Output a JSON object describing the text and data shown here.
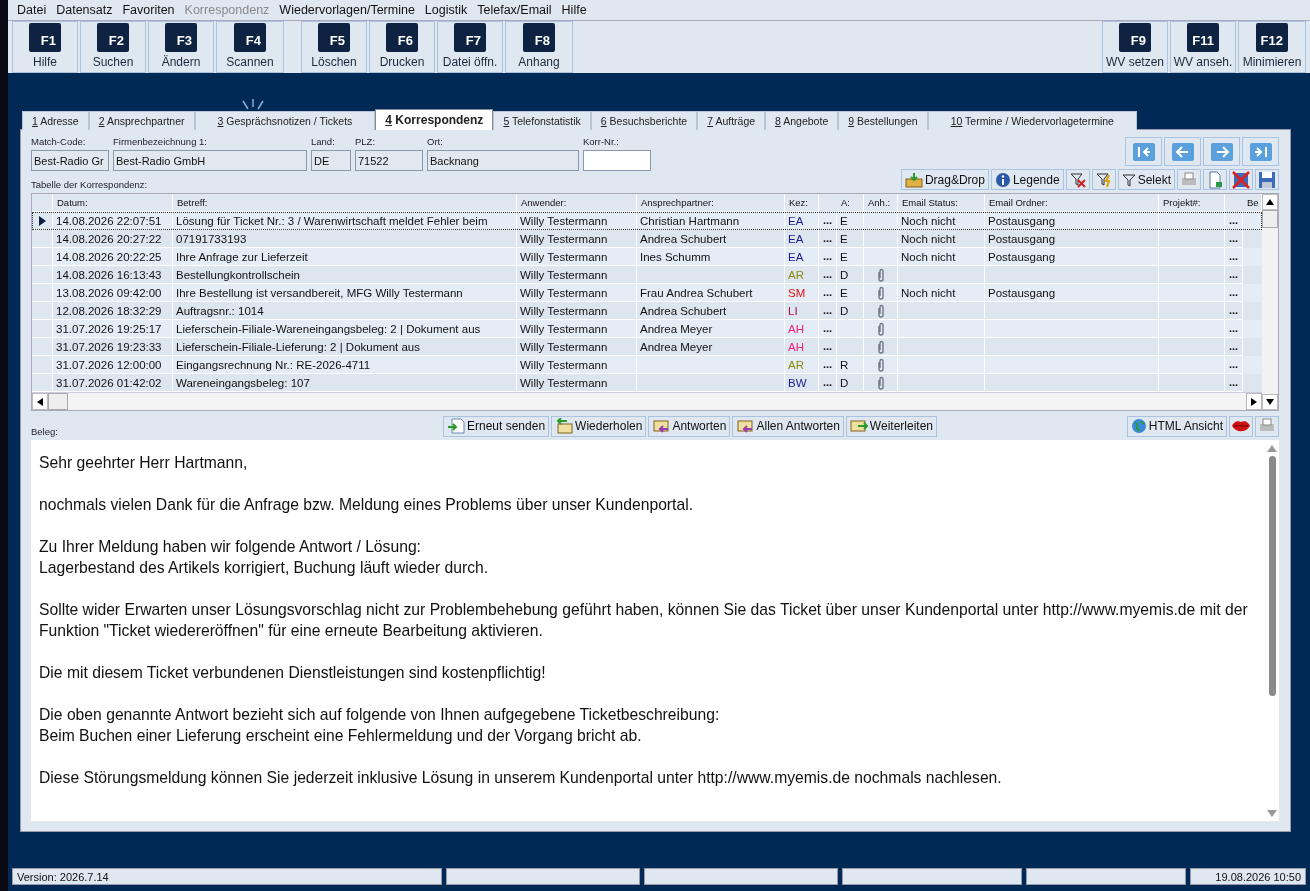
{
  "menu": [
    {
      "label": "Datei",
      "disabled": false
    },
    {
      "label": "Datensatz",
      "disabled": false
    },
    {
      "label": "Favoriten",
      "disabled": false
    },
    {
      "label": "Korrespondenz",
      "disabled": true
    },
    {
      "label": "Wiedervorlagen/Termine",
      "disabled": false
    },
    {
      "label": "Logistik",
      "disabled": false
    },
    {
      "label": "Telefax/Email",
      "disabled": false
    },
    {
      "label": "Hilfe",
      "disabled": false
    }
  ],
  "toolbar": {
    "groups": [
      [
        {
          "key": "F1",
          "label": "Hilfe"
        },
        {
          "key": "F2",
          "label": "Suchen"
        },
        {
          "key": "F3",
          "label": "Ändern"
        },
        {
          "key": "F4",
          "label": "Scannen"
        }
      ],
      [
        {
          "key": "F5",
          "label": "Löschen"
        },
        {
          "key": "F6",
          "label": "Drucken"
        },
        {
          "key": "F7",
          "label": "Datei öffn."
        },
        {
          "key": "F8",
          "label": "Anhang"
        }
      ]
    ],
    "right": [
      {
        "key": "F9",
        "label": "WV setzen"
      },
      {
        "key": "F11",
        "label": "WV anseh."
      },
      {
        "key": "F12",
        "label": "Minimieren"
      }
    ]
  },
  "tabs": [
    {
      "num": "1",
      "label": "Adresse",
      "selected": false
    },
    {
      "num": "2",
      "label": "Ansprechpartner",
      "selected": false
    },
    {
      "num": "3",
      "label": "Gesprächsnotizen / Tickets",
      "selected": false
    },
    {
      "num": "4",
      "label": "Korrespondenz",
      "selected": true
    },
    {
      "num": "5",
      "label": "Telefonstatistik",
      "selected": false
    },
    {
      "num": "6",
      "label": "Besuchsberichte",
      "selected": false
    },
    {
      "num": "7",
      "label": "Aufträge",
      "selected": false
    },
    {
      "num": "8",
      "label": "Angebote",
      "selected": false
    },
    {
      "num": "9",
      "label": "Bestellungen",
      "selected": false
    },
    {
      "num": "10",
      "label": "Termine / Wiedervorlagetermine",
      "selected": false
    }
  ],
  "fields": [
    {
      "label": "Match-Code:",
      "value": "Best-Radio Gr",
      "editable": false
    },
    {
      "label": "Firmenbezeichnung 1:",
      "value": "Best-Radio GmbH",
      "editable": false
    },
    {
      "label": "Land:",
      "value": "DE",
      "editable": false
    },
    {
      "label": "PLZ:",
      "value": "71522",
      "editable": false
    },
    {
      "label": "Ort:",
      "value": "Backnang",
      "editable": false
    },
    {
      "label": "Korr-Nr.:",
      "editable": true
    }
  ],
  "table_label": "Tabelle der Korrespondenz:",
  "table_tools": [
    {
      "kind": "dragdrop",
      "label": "Drag&Drop"
    },
    {
      "kind": "legend",
      "label": "Legende"
    },
    {
      "kind": "filter-off"
    },
    {
      "kind": "filter-flash"
    },
    {
      "kind": "filter",
      "label": "Selekt"
    },
    {
      "kind": "print"
    },
    {
      "kind": "export"
    },
    {
      "kind": "delete"
    },
    {
      "kind": "save"
    }
  ],
  "table": {
    "columns": [
      "Datum:",
      "Betreff:",
      "Anwender:",
      "Ansprechpartner:",
      "Kez:",
      "A:",
      "Anh.:",
      "Email Status:",
      "Email Ordner:",
      "Projekt#:",
      "Be"
    ],
    "rows": [
      {
        "selected": true,
        "date": "14.08.2026 22:07:51",
        "subject": "Lösung für Ticket Nr.: 3 / Warenwirtschaft meldet Fehler beim",
        "user": "Willy Testermann",
        "contact": "Christian Hartmann",
        "kez": "EA",
        "color": "#1c1c8c",
        "dots": "...",
        "a": "E",
        "attachment": false,
        "status": "Noch nicht",
        "folder": "Postausgang",
        "dots2": "..."
      },
      {
        "selected": false,
        "date": "14.08.2026 20:27:22",
        "subject": "07191733193",
        "user": "Willy Testermann",
        "contact": "Andrea Schubert",
        "kez": "EA",
        "color": "#1c1c8c",
        "dots": "...",
        "a": "E",
        "attachment": false,
        "status": "Noch nicht",
        "folder": "Postausgang",
        "dots2": "..."
      },
      {
        "selected": false,
        "date": "14.08.2026 20:22:25",
        "subject": "Ihre Anfrage zur Lieferzeit",
        "user": "Willy Testermann",
        "contact": "Ines Schumm",
        "kez": "EA",
        "color": "#1c1c8c",
        "dots": "...",
        "a": "E",
        "attachment": false,
        "status": "Noch nicht",
        "folder": "Postausgang",
        "dots2": "..."
      },
      {
        "selected": false,
        "date": "14.08.2026 16:13:43",
        "subject": "Bestellungkontrollschein",
        "user": "Willy Testermann",
        "kez": "AR",
        "color": "#8c8c10",
        "dots": "...",
        "a": "D",
        "attachment": true,
        "dots2": "..."
      },
      {
        "selected": false,
        "date": "13.08.2026 09:42:00",
        "subject": "Ihre Bestellung ist versandbereit, MFG Willy Testermann",
        "user": "Willy Testermann",
        "contact": "Frau Andrea Schubert",
        "kez": "SM",
        "color": "#e01010",
        "dots": "...",
        "a": "E",
        "attachment": true,
        "status": "Noch nicht",
        "folder": "Postausgang",
        "dots2": "..."
      },
      {
        "selected": false,
        "date": "12.08.2026 18:32:29",
        "subject": "Auftragsnr.: 1014",
        "user": "Willy Testermann",
        "contact": "Andrea Schubert",
        "kez": "LI",
        "color": "#a0105a",
        "dots": "...",
        "a": "D",
        "attachment": true,
        "dots2": "..."
      },
      {
        "selected": false,
        "date": "31.07.2026 19:25:17",
        "subject": "Lieferschein-Filiale-Wareneingangsbeleg: 2 | Dokument aus",
        "user": "Willy Testermann",
        "contact": "Andrea Meyer",
        "kez": "AH",
        "color": "#f0207a",
        "dots": "...",
        "attachment": true,
        "dots2": "..."
      },
      {
        "selected": false,
        "date": "31.07.2026 19:23:33",
        "subject": "Lieferschein-Filiale-Lieferung: 2 | Dokument aus",
        "user": "Willy Testermann",
        "contact": "Andrea Meyer",
        "kez": "AH",
        "color": "#f0207a",
        "dots": "...",
        "attachment": true,
        "dots2": "..."
      },
      {
        "selected": false,
        "date": "31.07.2026 12:00:00",
        "subject": "Eingangsrechnung Nr.: RE-2026-4711",
        "user": "Willy Testermann",
        "kez": "AR",
        "color": "#8c8c10",
        "dots": "...",
        "a": "R",
        "attachment": true,
        "dots2": "..."
      },
      {
        "selected": false,
        "date": "31.07.2026 01:42:02",
        "subject": "Wareneingangsbeleg: 107",
        "user": "Willy Testermann",
        "kez": "BW",
        "color": "#1c1c8c",
        "dots": "...",
        "a": "D",
        "attachment": true,
        "dots2": "..."
      }
    ]
  },
  "beleg_label": "Beleg:",
  "mail_actions": [
    {
      "kind": "resend",
      "label": "Erneut senden"
    },
    {
      "kind": "fetch",
      "label": "Wiederholen"
    },
    {
      "kind": "reply",
      "label": "Antworten"
    },
    {
      "kind": "reply",
      "label": "Allen Antworten"
    },
    {
      "kind": "forward",
      "label": "Weiterleiten"
    }
  ],
  "html_view": "HTML Ansicht",
  "letter": [
    [
      "Sehr geehrter Herr Hartmann,"
    ],
    [
      "nochmals vielen Dank für die Anfrage bzw. Meldung eines Problems über unser Kundenportal."
    ],
    [
      "Zu Ihrer Meldung haben wir folgende Antwort / Lösung:",
      "Lagerbestand des Artikels korrigiert, Buchung läuft wieder durch."
    ],
    [
      "Sollte wider Erwarten unser Lösungsvorschlag nicht zur Problembehebung geführt haben, können Sie das Ticket über unser Kundenportal unter http://www.myemis.de mit der Funktion \"Ticket wiedereröffnen\" für eine erneute Bearbeitung aktivieren."
    ],
    [
      "Die mit diesem Ticket verbundenen Dienstleistungen sind kostenpflichtig!"
    ],
    [
      "Die oben genannte Antwort bezieht sich auf folgende von Ihnen aufgegebene Ticketbeschreibung:",
      "Beim Buchen einer Lieferung erscheint eine Fehlermeldung und der Vorgang bricht ab."
    ],
    [
      "Diese Störungsmeldung können Sie jederzeit inklusive Lösung in unserem Kundenportal unter http://www.myemis.de nochmals nachlesen."
    ]
  ],
  "status_bar": {
    "version": "Version: 2026.7.14",
    "datetime": "19.08.2026 10:50"
  }
}
